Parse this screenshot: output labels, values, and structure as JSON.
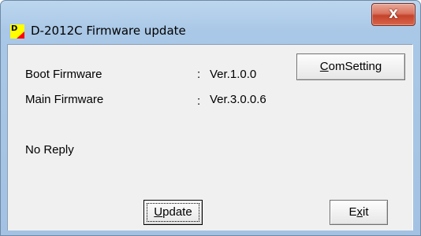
{
  "window": {
    "title": "D-2012C Firmware update",
    "icon_letter": "D",
    "close_glyph": "X"
  },
  "info": {
    "boot_label": "Boot Firmware",
    "boot_sep": ":",
    "boot_value": "Ver.1.0.0",
    "main_label": "Main Firmware",
    "main_sep": ":",
    "main_value": "Ver.3.0.0.6",
    "status": "No Reply"
  },
  "buttons": {
    "comsetting_mnemonic": "C",
    "comsetting_rest": "omSetting",
    "update_mnemonic": "U",
    "update_rest": "pdate",
    "exit_first": "E",
    "exit_mnemonic": "x",
    "exit_rest": "it"
  },
  "colors": {
    "title_bar": "#a9c7e6",
    "client_bg": "#f0f0f0",
    "close_button": "#c4432b",
    "icon_bg": "#ffff00",
    "icon_accent": "#ff0000"
  }
}
